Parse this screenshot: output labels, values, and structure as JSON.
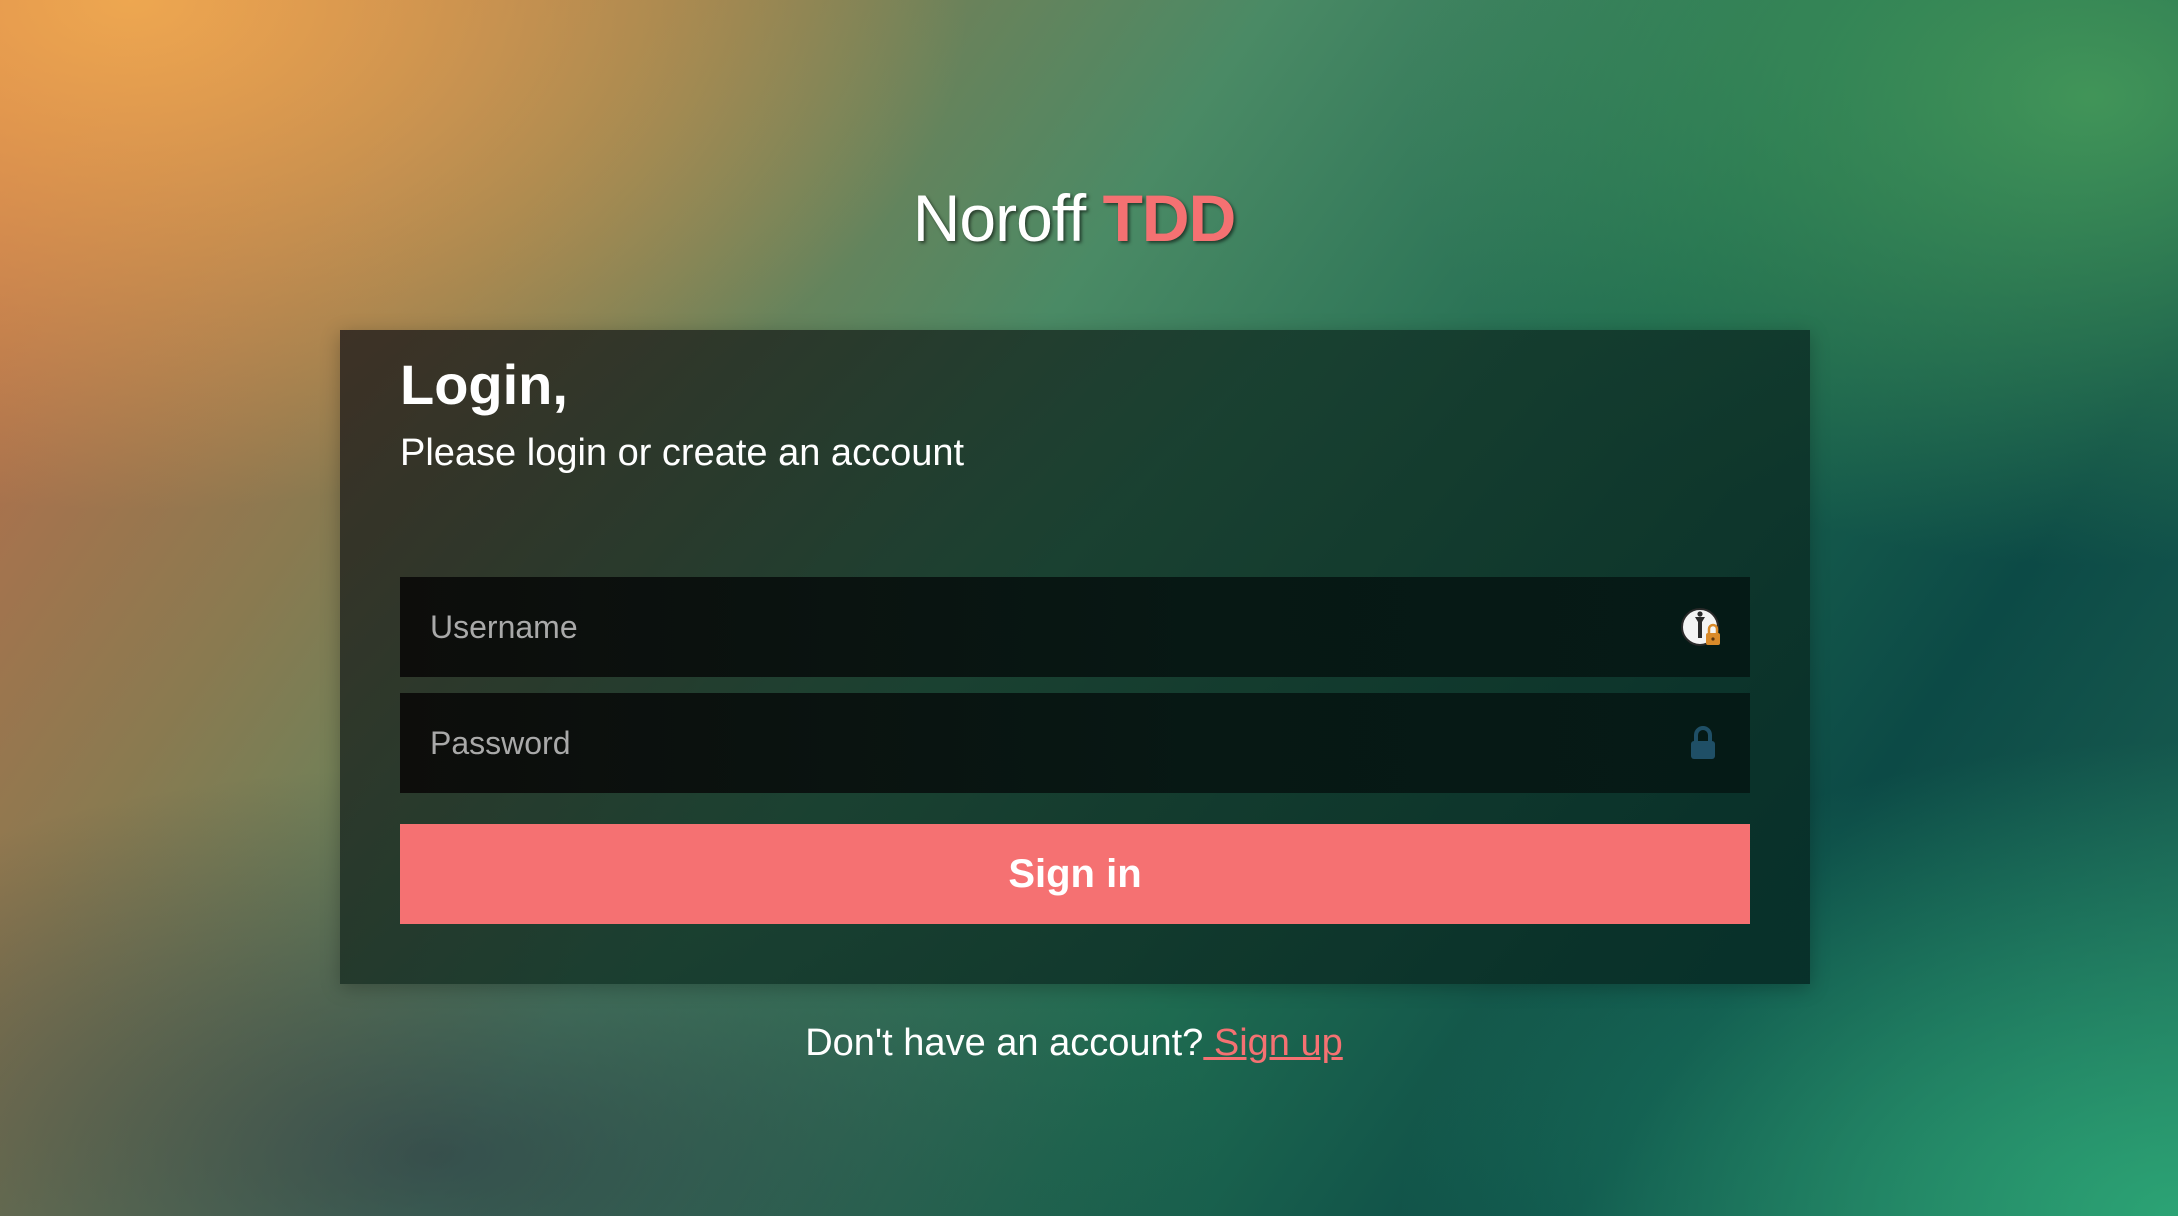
{
  "brand": {
    "name": "Noroff",
    "accent": "TDD"
  },
  "login": {
    "title": "Login,",
    "subtitle": "Please login or create an account",
    "username_placeholder": "Username",
    "password_placeholder": "Password",
    "signin_label": "Sign in",
    "username_icon": "password-manager-autofill-icon",
    "password_icon": "lock-icon"
  },
  "footer": {
    "prompt": "Don't have an account?",
    "signup_label": " Sign up"
  },
  "colors": {
    "accent": "#f57172",
    "text": "#ffffff",
    "input_bg": "#0a110f",
    "lock_icon": "#1f4f66"
  }
}
